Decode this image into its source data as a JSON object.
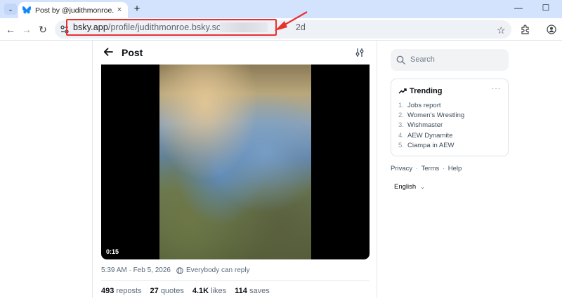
{
  "browser": {
    "tab_title": "Post by @judithmonroe.bsky",
    "close_glyph": "×",
    "newtab_glyph": "+",
    "menu_glyph": "⌄",
    "minimize_glyph": "—",
    "maximize_glyph": "☐",
    "back_glyph": "←",
    "forward_glyph": "→",
    "reload_glyph": "↻",
    "star_glyph": "☆",
    "url_domain": "bsky.app",
    "url_path": "/profile/judithmonroe.bsky.social/po",
    "url_end": "2d",
    "annotation_color": "#e8312f"
  },
  "post": {
    "title": "Post",
    "video_time": "0:15",
    "date": "5:39 AM · Feb 5, 2026",
    "reply_setting": "Everybody can reply",
    "stats": [
      {
        "count": "493",
        "label": "reposts"
      },
      {
        "count": "27",
        "label": "quotes"
      },
      {
        "count": "4.1K",
        "label": "likes"
      },
      {
        "count": "114",
        "label": "saves"
      }
    ]
  },
  "sidebar": {
    "search_placeholder": "Search",
    "trending_title": "Trending",
    "more_glyph": "···",
    "trending": [
      {
        "num": "1.",
        "label": "Jobs report"
      },
      {
        "num": "2.",
        "label": "Women's Wrestling"
      },
      {
        "num": "3.",
        "label": "Wishmaster"
      },
      {
        "num": "4.",
        "label": "AEW Dynamite"
      },
      {
        "num": "5.",
        "label": "Ciampa in AEW"
      }
    ],
    "links": {
      "privacy": "Privacy",
      "terms": "Terms",
      "help": "Help",
      "sep": "·"
    },
    "language": "English",
    "chevron": "⌄"
  },
  "colors": {
    "accent": "#1185fe",
    "annotation": "#e8312f"
  }
}
